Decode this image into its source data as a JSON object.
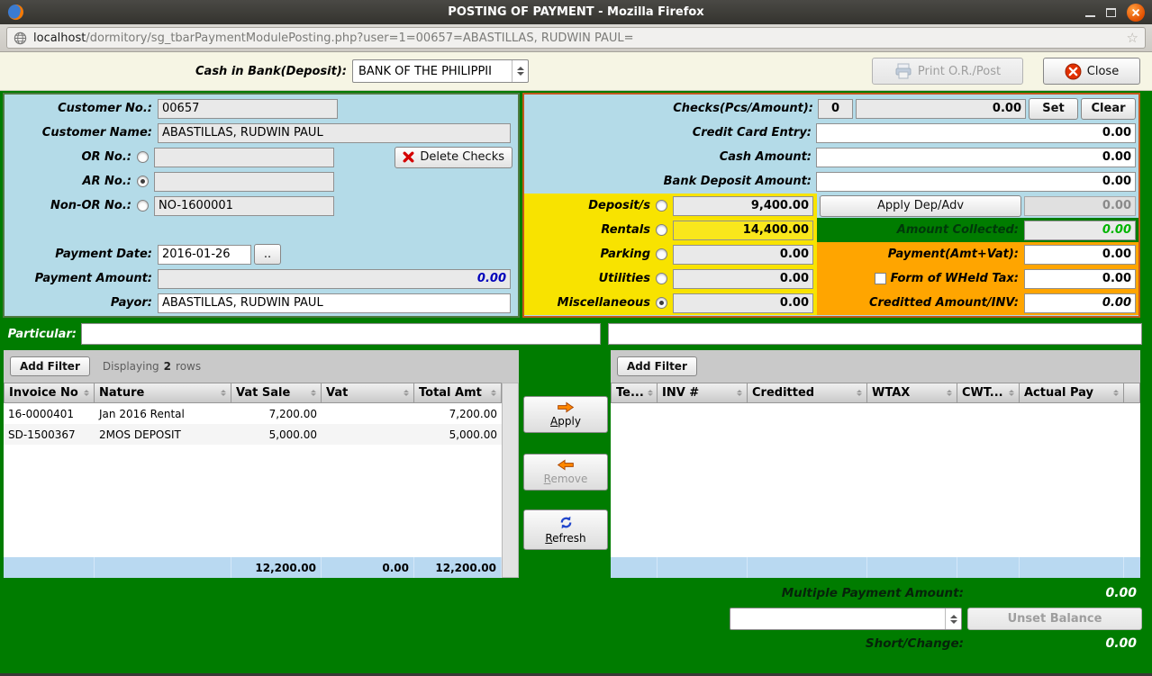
{
  "window": {
    "title": "POSTING OF PAYMENT - Mozilla Firefox"
  },
  "urlbar": {
    "host": "localhost",
    "path": "/dormitory/sg_tbarPaymentModulePosting.php?user=1=00657=ABASTILLAS, RUDWIN PAUL="
  },
  "toolbar": {
    "cash_in_bank_label": "Cash in Bank(Deposit):",
    "bank_value": "BANK OF THE PHILIPPII",
    "print_button": "Print O.R./Post",
    "close_button": "Close"
  },
  "customer": {
    "customer_no_label": "Customer No.:",
    "customer_no": "00657",
    "customer_name_label": "Customer Name:",
    "customer_name": "ABASTILLAS, RUDWIN PAUL",
    "or_no_label": "OR No.:",
    "or_no": "",
    "delete_checks_button": "Delete Checks",
    "ar_no_label": "AR No.:",
    "ar_no": "",
    "non_or_label": "Non-OR No.:",
    "non_or_no": "NO-1600001",
    "payment_date_label": "Payment Date:",
    "payment_date": "2016-01-26",
    "date_button": "..",
    "payment_amount_label": "Payment Amount:",
    "payment_amount": "0.00",
    "payor_label": "Payor:",
    "payor": "ABASTILLAS, RUDWIN PAUL"
  },
  "payment": {
    "checks_label": "Checks(Pcs/Amount):",
    "checks_pcs": "0",
    "checks_amount": "0.00",
    "set_button": "Set",
    "clear_button": "Clear",
    "credit_card_label": "Credit Card Entry:",
    "credit_card_amount": "0.00",
    "cash_label": "Cash Amount:",
    "cash_amount": "0.00",
    "bank_deposit_label": "Bank Deposit Amount:",
    "bank_deposit_amount": "0.00",
    "categories": [
      {
        "label": "Deposit/s",
        "value": "9,400.00",
        "selected": false,
        "highlight": false
      },
      {
        "label": "Rentals",
        "value": "14,400.00",
        "selected": false,
        "highlight": true
      },
      {
        "label": "Parking",
        "value": "0.00",
        "selected": false,
        "highlight": false
      },
      {
        "label": "Utilities",
        "value": "0.00",
        "selected": false,
        "highlight": false
      },
      {
        "label": "Miscellaneous",
        "value": "0.00",
        "selected": true,
        "highlight": false
      }
    ],
    "apply_dep_adv_button": "Apply Dep/Adv",
    "dep_adv_amount": "0.00",
    "amount_collected_label": "Amount Collected:",
    "amount_collected": "0.00",
    "payment_amt_vat_label": "Payment(Amt+Vat):",
    "payment_amt_vat": "0.00",
    "wheld_tax_label": "Form of WHeld Tax:",
    "wheld_tax_amount": "0.00",
    "creditted_label": "Creditted Amount/INV:",
    "creditted_amount": "0.00"
  },
  "particular": {
    "label": "Particular:",
    "left_value": "",
    "right_value": ""
  },
  "invoice_table": {
    "add_filter_button": "Add Filter",
    "displaying_prefix": "Displaying",
    "row_count": "2",
    "displaying_suffix": "rows",
    "columns": [
      "Invoice No",
      "Nature",
      "Vat Sale",
      "Vat",
      "Total Amt"
    ],
    "rows": [
      {
        "invoice_no": "16-0000401",
        "nature": "Jan 2016 Rental",
        "vat_sale": "7,200.00",
        "vat": "",
        "total_amt": "7,200.00"
      },
      {
        "invoice_no": "SD-1500367",
        "nature": "2MOS DEPOSIT",
        "vat_sale": "5,000.00",
        "vat": "",
        "total_amt": "5,000.00"
      }
    ],
    "totals": {
      "vat_sale": "12,200.00",
      "vat": "0.00",
      "total_amt": "12,200.00"
    }
  },
  "actions": {
    "apply_button": "Apply",
    "remove_button": "Remove",
    "refresh_button": "Refresh"
  },
  "applied_table": {
    "add_filter_button": "Add Filter",
    "columns": [
      "Te...",
      "INV #",
      "Creditted",
      "WTAX",
      "CWT...",
      "Actual Pay"
    ]
  },
  "footer": {
    "multiple_payment_label": "Multiple Payment Amount:",
    "multiple_payment_amount": "0.00",
    "unset_balance_button": "Unset Balance",
    "short_change_label": "Short/Change:",
    "short_change_amount": "0.00"
  },
  "colors": {
    "desktop_green": "#007c00",
    "panel_blue": "#b4dbe8",
    "category_yellow": "#f8e300",
    "tax_orange": "#ffa500",
    "amount_collected_green": "#00b400",
    "payment_amount_blue": "#0000bb",
    "grid_footer_blue": "#b9d9f1"
  }
}
